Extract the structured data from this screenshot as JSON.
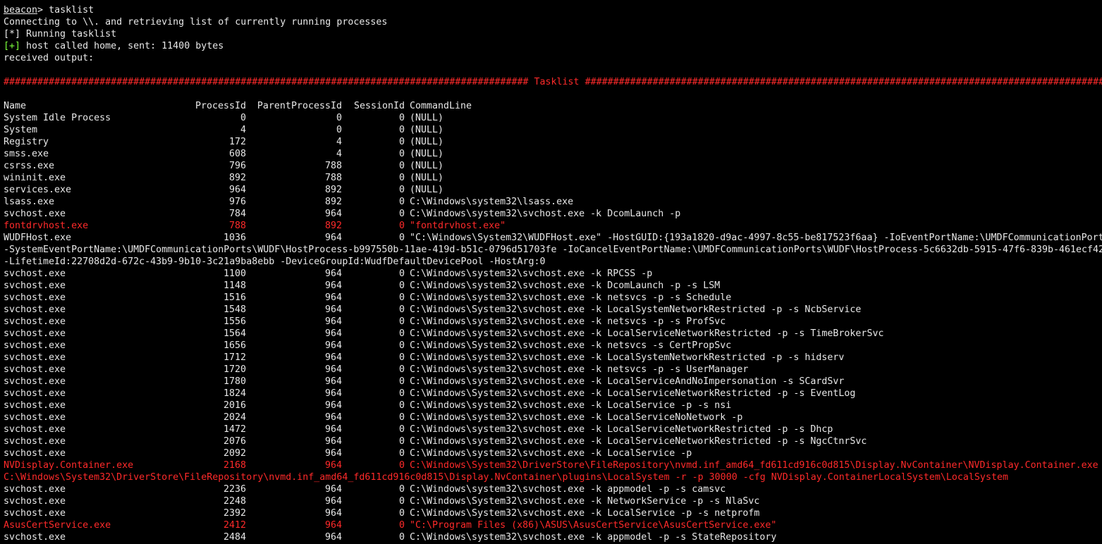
{
  "prompt": {
    "label": "beacon",
    "symbol": ">",
    "command": " tasklist"
  },
  "status_lines": [
    "Connecting to \\\\. and retrieving list of currently running processes",
    "[*] Running tasklist"
  ],
  "callback": {
    "tag": "[+]",
    "text": " host called home, sent: 11400 bytes"
  },
  "received": "received output:",
  "banner": {
    "left": "#############################################################################################",
    "title": " Tasklist ",
    "right": "##############################################################################################"
  },
  "columns": {
    "name": "Name",
    "pid": "ProcessId",
    "ppid": "ParentProcessId",
    "sid": "SessionId",
    "cmd": "CommandLine"
  },
  "colors": {
    "background": "#000000",
    "text": "#e8e8e8",
    "highlight": "#ff2a2a",
    "success": "#7cff3a"
  },
  "processes": [
    {
      "name": "System Idle Process",
      "pid": "0",
      "ppid": "0",
      "sid": "0",
      "cmd": "(NULL)",
      "highlight": false
    },
    {
      "name": "System",
      "pid": "4",
      "ppid": "0",
      "sid": "0",
      "cmd": "(NULL)",
      "highlight": false
    },
    {
      "name": "Registry",
      "pid": "172",
      "ppid": "4",
      "sid": "0",
      "cmd": "(NULL)",
      "highlight": false
    },
    {
      "name": "smss.exe",
      "pid": "608",
      "ppid": "4",
      "sid": "0",
      "cmd": "(NULL)",
      "highlight": false
    },
    {
      "name": "csrss.exe",
      "pid": "796",
      "ppid": "788",
      "sid": "0",
      "cmd": "(NULL)",
      "highlight": false
    },
    {
      "name": "wininit.exe",
      "pid": "892",
      "ppid": "788",
      "sid": "0",
      "cmd": "(NULL)",
      "highlight": false
    },
    {
      "name": "services.exe",
      "pid": "964",
      "ppid": "892",
      "sid": "0",
      "cmd": "(NULL)",
      "highlight": false
    },
    {
      "name": "lsass.exe",
      "pid": "976",
      "ppid": "892",
      "sid": "0",
      "cmd": "C:\\Windows\\system32\\lsass.exe",
      "highlight": false
    },
    {
      "name": "svchost.exe",
      "pid": "784",
      "ppid": "964",
      "sid": "0",
      "cmd": "C:\\Windows\\system32\\svchost.exe -k DcomLaunch -p",
      "highlight": false
    },
    {
      "name": "fontdrvhost.exe",
      "pid": "788",
      "ppid": "892",
      "sid": "0",
      "cmd": "\"fontdrvhost.exe\"",
      "highlight": true
    },
    {
      "name": "WUDFHost.exe",
      "pid": "1036",
      "ppid": "964",
      "sid": "0",
      "cmd": "\"C:\\Windows\\System32\\WUDFHost.exe\" -HostGUID:{193a1820-d9ac-4997-8c55-be817523f6aa} -IoEventPortName:\\UMDFCommunicationPort",
      "highlight": false,
      "wrap": [
        "-SystemEventPortName:\\UMDFCommunicationPorts\\WUDF\\HostProcess-b997550b-11ae-419d-b51c-0796d51703fe -IoCancelEventPortName:\\UMDFCommunicationPorts\\WUDF\\HostProcess-5c6632db-5915-47f6-839b-461ecf42",
        "-LifetimeId:22708d2d-672c-43b9-9b10-3c21a9ba8ebb -DeviceGroupId:WudfDefaultDevicePool -HostArg:0"
      ]
    },
    {
      "name": "svchost.exe",
      "pid": "1100",
      "ppid": "964",
      "sid": "0",
      "cmd": "C:\\Windows\\system32\\svchost.exe -k RPCSS -p",
      "highlight": false
    },
    {
      "name": "svchost.exe",
      "pid": "1148",
      "ppid": "964",
      "sid": "0",
      "cmd": "C:\\Windows\\system32\\svchost.exe -k DcomLaunch -p -s LSM",
      "highlight": false
    },
    {
      "name": "svchost.exe",
      "pid": "1516",
      "ppid": "964",
      "sid": "0",
      "cmd": "C:\\Windows\\system32\\svchost.exe -k netsvcs -p -s Schedule",
      "highlight": false
    },
    {
      "name": "svchost.exe",
      "pid": "1548",
      "ppid": "964",
      "sid": "0",
      "cmd": "C:\\Windows\\System32\\svchost.exe -k LocalSystemNetworkRestricted -p -s NcbService",
      "highlight": false
    },
    {
      "name": "svchost.exe",
      "pid": "1556",
      "ppid": "964",
      "sid": "0",
      "cmd": "C:\\Windows\\system32\\svchost.exe -k netsvcs -p -s ProfSvc",
      "highlight": false
    },
    {
      "name": "svchost.exe",
      "pid": "1564",
      "ppid": "964",
      "sid": "0",
      "cmd": "C:\\Windows\\system32\\svchost.exe -k LocalServiceNetworkRestricted -p -s TimeBrokerSvc",
      "highlight": false
    },
    {
      "name": "svchost.exe",
      "pid": "1656",
      "ppid": "964",
      "sid": "0",
      "cmd": "C:\\Windows\\System32\\svchost.exe -k netsvcs -s CertPropSvc",
      "highlight": false
    },
    {
      "name": "svchost.exe",
      "pid": "1712",
      "ppid": "964",
      "sid": "0",
      "cmd": "C:\\Windows\\system32\\svchost.exe -k LocalSystemNetworkRestricted -p -s hidserv",
      "highlight": false
    },
    {
      "name": "svchost.exe",
      "pid": "1720",
      "ppid": "964",
      "sid": "0",
      "cmd": "C:\\Windows\\system32\\svchost.exe -k netsvcs -p -s UserManager",
      "highlight": false
    },
    {
      "name": "svchost.exe",
      "pid": "1780",
      "ppid": "964",
      "sid": "0",
      "cmd": "C:\\Windows\\system32\\svchost.exe -k LocalServiceAndNoImpersonation -s SCardSvr",
      "highlight": false
    },
    {
      "name": "svchost.exe",
      "pid": "1824",
      "ppid": "964",
      "sid": "0",
      "cmd": "C:\\Windows\\System32\\svchost.exe -k LocalServiceNetworkRestricted -p -s EventLog",
      "highlight": false
    },
    {
      "name": "svchost.exe",
      "pid": "2016",
      "ppid": "964",
      "sid": "0",
      "cmd": "C:\\Windows\\system32\\svchost.exe -k LocalService -p -s nsi",
      "highlight": false
    },
    {
      "name": "svchost.exe",
      "pid": "2024",
      "ppid": "964",
      "sid": "0",
      "cmd": "C:\\Windows\\system32\\svchost.exe -k LocalServiceNoNetwork -p",
      "highlight": false
    },
    {
      "name": "svchost.exe",
      "pid": "1472",
      "ppid": "964",
      "sid": "0",
      "cmd": "C:\\Windows\\system32\\svchost.exe -k LocalServiceNetworkRestricted -p -s Dhcp",
      "highlight": false
    },
    {
      "name": "svchost.exe",
      "pid": "2076",
      "ppid": "964",
      "sid": "0",
      "cmd": "C:\\Windows\\system32\\svchost.exe -k LocalServiceNetworkRestricted -p -s NgcCtnrSvc",
      "highlight": false
    },
    {
      "name": "svchost.exe",
      "pid": "2092",
      "ppid": "964",
      "sid": "0",
      "cmd": "C:\\Windows\\system32\\svchost.exe -k LocalService -p",
      "highlight": false
    },
    {
      "name": "NVDisplay.Container.exe",
      "pid": "2168",
      "ppid": "964",
      "sid": "0",
      "cmd": "C:\\Windows\\System32\\DriverStore\\FileRepository\\nvmd.inf_amd64_fd611cd916c0d815\\Display.NvContainer\\NVDisplay.Container.exe",
      "highlight": true,
      "wrap": [
        "C:\\Windows\\System32\\DriverStore\\FileRepository\\nvmd.inf_amd64_fd611cd916c0d815\\Display.NvContainer\\plugins\\LocalSystem -r -p 30000 -cfg NVDisplay.ContainerLocalSystem\\LocalSystem"
      ]
    },
    {
      "name": "svchost.exe",
      "pid": "2236",
      "ppid": "964",
      "sid": "0",
      "cmd": "C:\\Windows\\system32\\svchost.exe -k appmodel -p -s camsvc",
      "highlight": false
    },
    {
      "name": "svchost.exe",
      "pid": "2248",
      "ppid": "964",
      "sid": "0",
      "cmd": "C:\\Windows\\System32\\svchost.exe -k NetworkService -p -s NlaSvc",
      "highlight": false
    },
    {
      "name": "svchost.exe",
      "pid": "2392",
      "ppid": "964",
      "sid": "0",
      "cmd": "C:\\Windows\\System32\\svchost.exe -k LocalService -p -s netprofm",
      "highlight": false
    },
    {
      "name": "AsusCertService.exe",
      "pid": "2412",
      "ppid": "964",
      "sid": "0",
      "cmd": "\"C:\\Program Files (x86)\\ASUS\\AsusCertService\\AsusCertService.exe\"",
      "highlight": true
    },
    {
      "name": "svchost.exe",
      "pid": "2484",
      "ppid": "964",
      "sid": "0",
      "cmd": "C:\\Windows\\system32\\svchost.exe -k appmodel -p -s StateRepository",
      "highlight": false
    }
  ]
}
